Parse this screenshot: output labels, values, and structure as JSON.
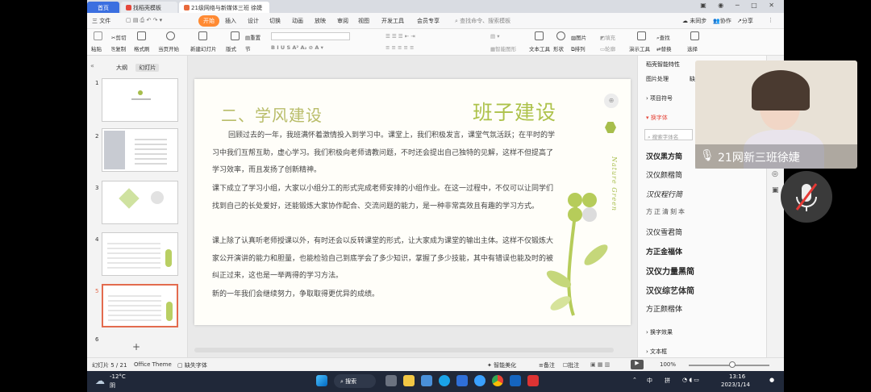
{
  "tabs": {
    "home": "首页",
    "template": "找稻壳模板",
    "doc": "21级网络与新媒体三班 徐婕"
  },
  "menu": {
    "file": "三 文件",
    "items": [
      "开始",
      "插入",
      "设计",
      "切换",
      "动画",
      "放映",
      "审阅",
      "视图",
      "开发工具",
      "会员专享"
    ],
    "search": "查找命令、搜索模板",
    "sync": "未同步",
    "collab": "协作",
    "share": "分享"
  },
  "ribbon": {
    "paste": "粘贴",
    "cut": "剪切",
    "copy": "复制",
    "format": "格式刷",
    "from_start": "当页开始",
    "new_slide": "新建幻灯片",
    "layout": "版式",
    "section": "节",
    "reset": "重置",
    "text_tools": "文本工具",
    "textbox": "文本框",
    "shape": "形状",
    "arrange": "排列",
    "picture": "图片",
    "fill": "填充",
    "outline": "轮廓",
    "find": "查找",
    "select": "选择",
    "presenter": "演示工具",
    "replace": "替换",
    "smart_graphic": "智能图形"
  },
  "leftpanel": {
    "outline_tab": "大纲",
    "slides_tab": "幻灯片",
    "slide_numbers": [
      "1",
      "2",
      "3",
      "4",
      "5",
      "6"
    ],
    "add": "+"
  },
  "slide": {
    "title": "二、学风建设",
    "big_title": "班子建设",
    "vertical": "Nature Green",
    "p1": "回顾过去的一年，我班满怀着激情投入到学习中。课堂上，我们积极发言，课堂气氛活跃；在平时的学习中我们互帮互助，虚心学习。我们积极向老师请教问题，不时还会提出自己独特的见解，这样不但提高了学习效率，而且发扬了创新精神。",
    "p2": "课下成立了学习小组，大家以小组分工的形式完成老师安排的小组作业。在这一过程中，不仅可以让同学们找到自己的长处爱好，还能锻炼大家协作配合、交流问题的能力，是一种非常高效且有趣的学习方式。",
    "p3": "课上除了认真听老师授课以外，有时还会以反转课堂的形式，让大家成为课堂的输出主体。这样不仅锻炼大家公开演讲的能力和胆量，也能检验自己到底学会了多少知识，掌握了多少技能，其中有错误也能及时的被纠正过来，这也是一举两得的学习方法。",
    "p4": "新的一年我们会继续努力，争取取得更优异的成绩。"
  },
  "rightpanel": {
    "header": "稻壳智能特性",
    "tab1": "图片处理",
    "tab2": "缺",
    "section1": "项目符号",
    "section2": "换字体",
    "search": "搜索字体名",
    "fonts": [
      "汉仪黑方简",
      "汉仪颜楷简",
      "汉仪程行简",
      "方正清刻本",
      "汉仪雪君简",
      "方正金福体",
      "汉仪力量黑简",
      "汉仪综艺体简",
      "方正颜楷体"
    ],
    "section3": "换字效果",
    "section4": "文本框"
  },
  "status": {
    "slide": "幻灯片 5 / 21",
    "theme": "Office Theme",
    "missing_font": "缺失字体",
    "beautify": "智能美化",
    "notes": "备注",
    "comments": "批注",
    "zoom": "100%"
  },
  "taskbar": {
    "weather_temp": "-12°C",
    "weather_desc": "阴",
    "search": "搜索",
    "ime1": "中",
    "ime2": "拼",
    "time": "13:16",
    "date": "2023/1/14"
  },
  "video": {
    "name": "21网新三班徐婕"
  },
  "colors": {
    "accent": "#ff8a33",
    "title_green": "#b9bd6a",
    "leaf_green": "#a7be4c",
    "tab_blue": "#3b6fe0",
    "taskbar": "#202839"
  }
}
